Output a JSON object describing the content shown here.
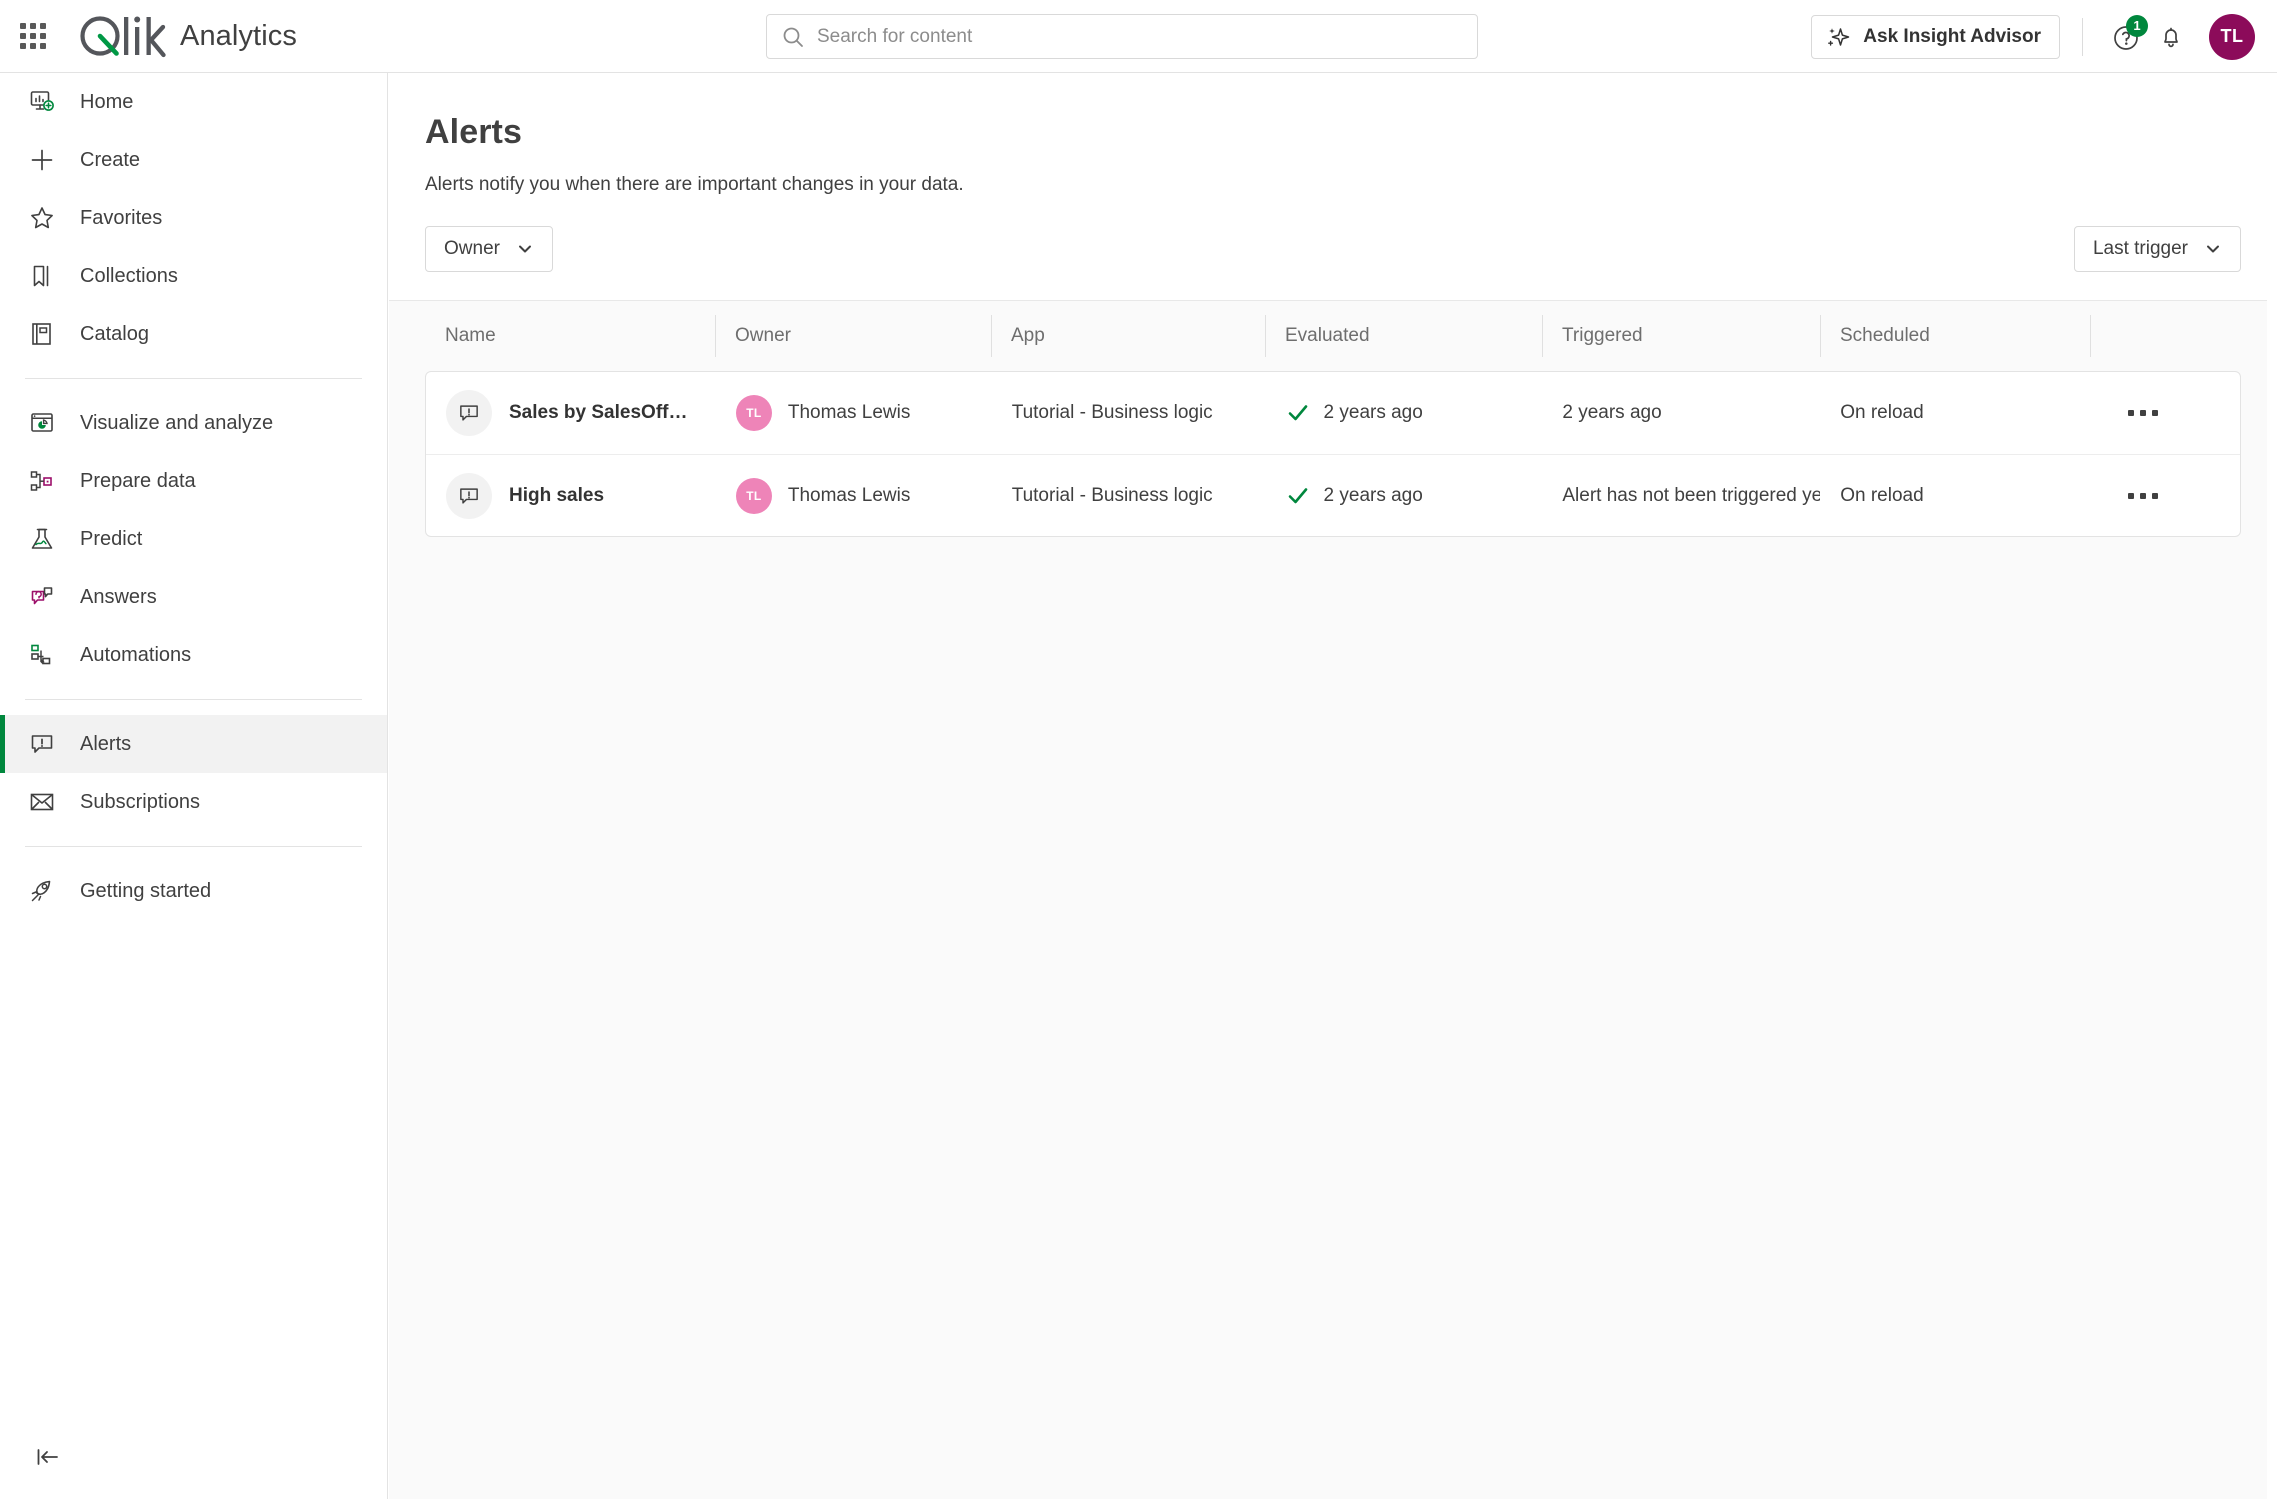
{
  "topbar": {
    "waffle_icon": "apps-grid-icon",
    "logo_text": "Qlik",
    "product_name": "Analytics",
    "search": {
      "placeholder": "Search for content",
      "value": "",
      "icon": "search-icon"
    },
    "ask_insight_advisor": {
      "label": "Ask Insight Advisor",
      "icon": "sparkle-icon"
    },
    "help": {
      "icon": "help-circle-icon",
      "badge": "1",
      "badge_color": "#00873d"
    },
    "notifications": {
      "icon": "bell-icon"
    },
    "user_avatar": {
      "initials": "TL",
      "color": "#8c0b5a"
    }
  },
  "sidebar": {
    "groups": [
      {
        "items": [
          {
            "label": "Home",
            "icon": "home-dashboard-icon",
            "selected": false
          },
          {
            "label": "Create",
            "icon": "plus-icon",
            "selected": false
          },
          {
            "label": "Favorites",
            "icon": "star-icon",
            "selected": false
          },
          {
            "label": "Collections",
            "icon": "bookmark-icon",
            "selected": false
          },
          {
            "label": "Catalog",
            "icon": "catalog-book-icon",
            "selected": false
          }
        ]
      },
      {
        "items": [
          {
            "label": "Visualize and analyze",
            "icon": "chart-window-icon",
            "selected": false
          },
          {
            "label": "Prepare data",
            "icon": "data-nodes-icon",
            "selected": false
          },
          {
            "label": "Predict",
            "icon": "flask-icon",
            "selected": false
          },
          {
            "label": "Answers",
            "icon": "chat-bulb-icon",
            "selected": false
          },
          {
            "label": "Automations",
            "icon": "automation-flow-icon",
            "selected": false
          }
        ]
      },
      {
        "items": [
          {
            "label": "Alerts",
            "icon": "alert-bubble-icon",
            "selected": true
          },
          {
            "label": "Subscriptions",
            "icon": "envelope-icon",
            "selected": false
          }
        ]
      },
      {
        "items": [
          {
            "label": "Getting started",
            "icon": "rocket-icon",
            "selected": false
          }
        ]
      }
    ],
    "collapse": {
      "icon": "collapse-left-icon",
      "label": "Collapse"
    }
  },
  "page": {
    "title": "Alerts",
    "description": "Alerts notify you when there are important changes in your data.",
    "filters": {
      "owner": {
        "label": "Owner",
        "icon": "chevron-down-icon"
      },
      "sort": {
        "label": "Last trigger",
        "icon": "chevron-down-icon"
      }
    }
  },
  "table": {
    "columns": [
      {
        "key": "name",
        "label": "Name"
      },
      {
        "key": "owner",
        "label": "Owner"
      },
      {
        "key": "app",
        "label": "App"
      },
      {
        "key": "evaluated",
        "label": "Evaluated"
      },
      {
        "key": "triggered",
        "label": "Triggered"
      },
      {
        "key": "scheduled",
        "label": "Scheduled"
      },
      {
        "key": "actions",
        "label": ""
      }
    ],
    "rows": [
      {
        "name": "Sales by SalesOff…",
        "name_icon": "alert-bubble-icon",
        "owner": "Thomas Lewis",
        "owner_initials": "TL",
        "owner_color": "#ee84b8",
        "app": "Tutorial - Business logic",
        "evaluated": "2 years ago",
        "evaluated_status_icon": "check-icon",
        "evaluated_status_color": "#00873d",
        "triggered": "2 years ago",
        "scheduled": "On reload",
        "actions_icon": "more-options-icon"
      },
      {
        "name": "High sales",
        "name_icon": "alert-bubble-icon",
        "owner": "Thomas Lewis",
        "owner_initials": "TL",
        "owner_color": "#ee84b8",
        "app": "Tutorial - Business logic",
        "evaluated": "2 years ago",
        "evaluated_status_icon": "check-icon",
        "evaluated_status_color": "#00873d",
        "triggered": "Alert has not been triggered yet",
        "scheduled": "On reload",
        "actions_icon": "more-options-icon"
      }
    ]
  }
}
